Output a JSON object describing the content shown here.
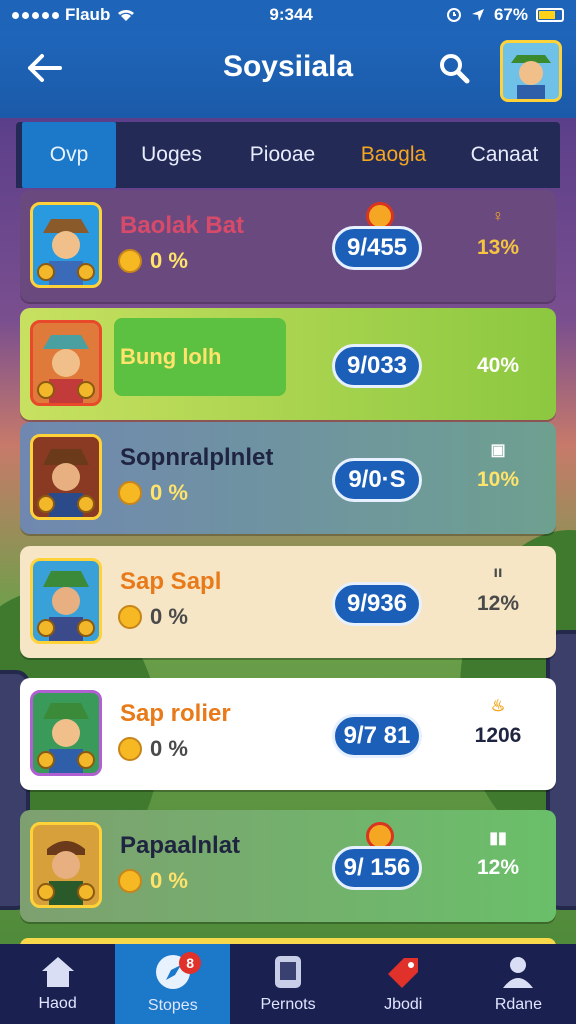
{
  "status_bar": {
    "carrier": "Flaub",
    "time": "9:344",
    "battery": "67%"
  },
  "header": {
    "title": "Soysiiala",
    "back_icon": "arrow-left-icon",
    "search_icon": "search-icon"
  },
  "tabs": [
    {
      "label": "Ovp",
      "state": "active"
    },
    {
      "label": "Uoges",
      "state": "normal"
    },
    {
      "label": "Piooae",
      "state": "normal"
    },
    {
      "label": "Baogla",
      "state": "highlight"
    },
    {
      "label": "Canaat",
      "state": "normal"
    }
  ],
  "rows": [
    {
      "name": "Baolak Bat",
      "coins": "0 %",
      "score": "9/455",
      "percent": "13%",
      "glyph": "♀",
      "bg": "#6a4a7e",
      "name_color": "#d84a6a",
      "coins_color": "#ffe36b",
      "avatar_bg": "#2a9ae0",
      "has_badge": true
    },
    {
      "name": "Bung lolh",
      "coins": "",
      "score": "9/033",
      "percent": "40%",
      "glyph": "",
      "bg": "#9ac94c",
      "name_color": "#ffe36b",
      "coins_color": "#ffe36b",
      "avatar_bg": "#e07a3a",
      "has_badge": false
    },
    {
      "name": "Sopnralplnlet",
      "coins": "0 %",
      "score": "9/0·S",
      "percent": "10%",
      "glyph": "▣",
      "bg": "#6f8fa0",
      "name_color": "#1f2440",
      "coins_color": "#ffe36b",
      "avatar_bg": "#8a3a22",
      "has_badge": false
    },
    {
      "name": "Sap Sapl",
      "coins": "0 %",
      "score": "9/936",
      "percent": "12%",
      "glyph": "ıı",
      "bg": "#f6e6c6",
      "name_color": "#e87a1a",
      "coins_color": "#4a4a4a",
      "avatar_bg": "#3aa0d8",
      "has_badge": false
    },
    {
      "name": "Sap rolier",
      "coins": "0 %",
      "score": "9/7 81",
      "percent": "1206",
      "glyph": "♨",
      "bg": "#ffffff",
      "name_color": "#e87a1a",
      "coins_color": "#4a4a4a",
      "avatar_bg": "#3a9a5a",
      "has_badge": false
    },
    {
      "name": "Papaalnlat",
      "coins": "0 %",
      "score": "9/ 156",
      "percent": "12%",
      "glyph": "▮▮",
      "bg": "#6ea06a",
      "name_color": "#1f2440",
      "coins_color": "#ffe36b",
      "avatar_bg": "#d8a03a",
      "has_badge": true
    }
  ],
  "bottom_nav": [
    {
      "label": "Haod",
      "icon": "home-icon",
      "active": false
    },
    {
      "label": "Stopes",
      "icon": "compass-icon",
      "active": true,
      "badge": "8"
    },
    {
      "label": "Pernots",
      "icon": "phone-icon",
      "active": false
    },
    {
      "label": "Jbodi",
      "icon": "tag-icon",
      "active": false
    },
    {
      "label": "Rdane",
      "icon": "profile-icon",
      "active": false
    }
  ],
  "colors": {
    "header": "#1f66bb",
    "tabs_bg": "#232a55",
    "active_tab": "#1c78c8",
    "pill": "#1b5fb8"
  }
}
